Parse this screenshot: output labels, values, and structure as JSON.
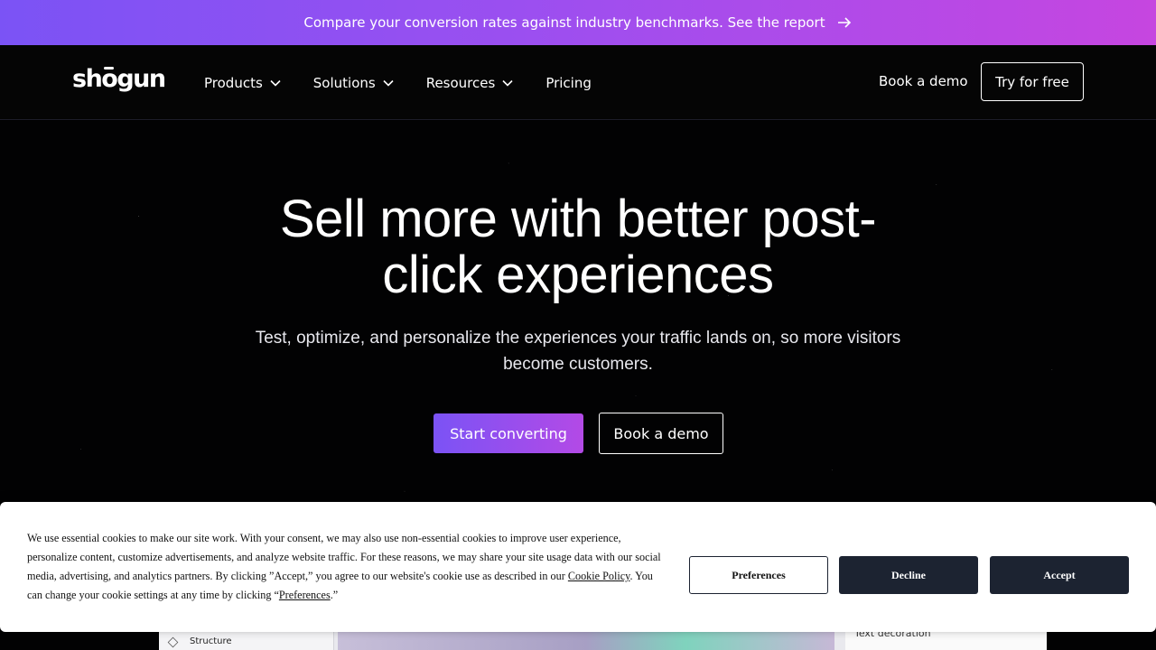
{
  "promo": {
    "text": "Compare your conversion rates against industry benchmarks. See the report",
    "icon": "arrow-right-icon"
  },
  "nav": {
    "logo": {
      "pre": "sh",
      "o": "o",
      "post": "gun"
    },
    "items": [
      {
        "label": "Products",
        "icon": "chevron-down-icon"
      },
      {
        "label": "Solutions",
        "icon": "chevron-down-icon"
      },
      {
        "label": "Resources",
        "icon": "chevron-down-icon"
      },
      {
        "label": "Pricing"
      }
    ],
    "book_demo": "Book a demo",
    "try_free": "Try for free"
  },
  "hero": {
    "headline_line1": "Sell more with better post-",
    "headline_line2": "click experiences",
    "subhead": "Test, optimize, and personalize the experiences your traffic lands on, so more visitors become customers.",
    "cta_primary": "Start converting",
    "cta_secondary": "Book a demo"
  },
  "preview": {
    "left_label": "Structure",
    "right_label": "Text decoration"
  },
  "cookie": {
    "text_part1": "We use essential cookies to make our site work. With your consent, we may also use non-essential cookies to improve user experience, personalize content, customize advertisements, and analyze website traffic. For these reasons, we may share your site usage data with our social media, advertising, and analytics partners. By clicking ”Accept,” you agree to our website's cookie use as described in our ",
    "policy_link": "Cookie Policy",
    "text_part2": ". You can change your cookie settings at any time by clicking “",
    "preferences_link": "Preferences",
    "text_part3": ".”",
    "preferences_button": "Preferences",
    "decline_button": "Decline",
    "accept_button": "Accept"
  },
  "colors": {
    "accent_start": "#7b53f5",
    "accent_end": "#c646e0",
    "cookie_button": "#1c2331"
  }
}
